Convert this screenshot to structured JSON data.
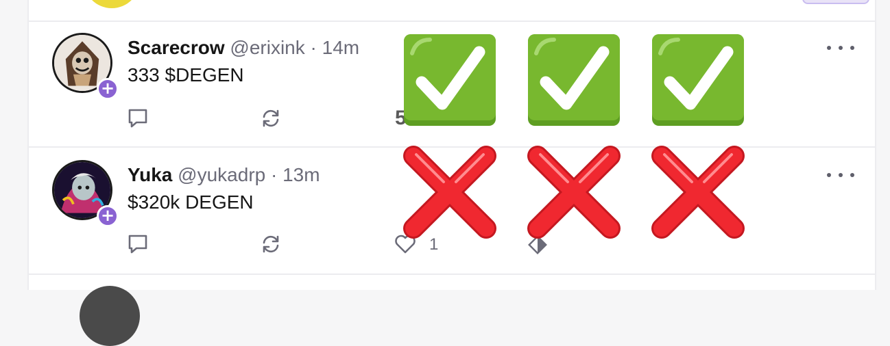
{
  "feed": {
    "casts": [
      {
        "display_name": "Scarecrow",
        "handle": "@erixink",
        "separator": "·",
        "time": "14m",
        "text": "333 $DEGEN",
        "follow_symbol": "+",
        "partial_count": "5"
      },
      {
        "display_name": "Yuka",
        "handle": "@yukadrp",
        "separator": "·",
        "time": "13m",
        "text": "$320k DEGEN",
        "follow_symbol": "+",
        "like_count": "1"
      }
    ]
  },
  "overlay": {
    "row_1": [
      "check-mark-button-emoji",
      "check-mark-button-emoji",
      "check-mark-button-emoji"
    ],
    "row_2": [
      "cross-mark-emoji",
      "cross-mark-emoji",
      "cross-mark-emoji"
    ]
  },
  "colors": {
    "accent_purple": "#8a63d2",
    "check_green": "#6aae2a",
    "cross_red": "#e8202c",
    "icon_gray": "#6b6b78"
  }
}
